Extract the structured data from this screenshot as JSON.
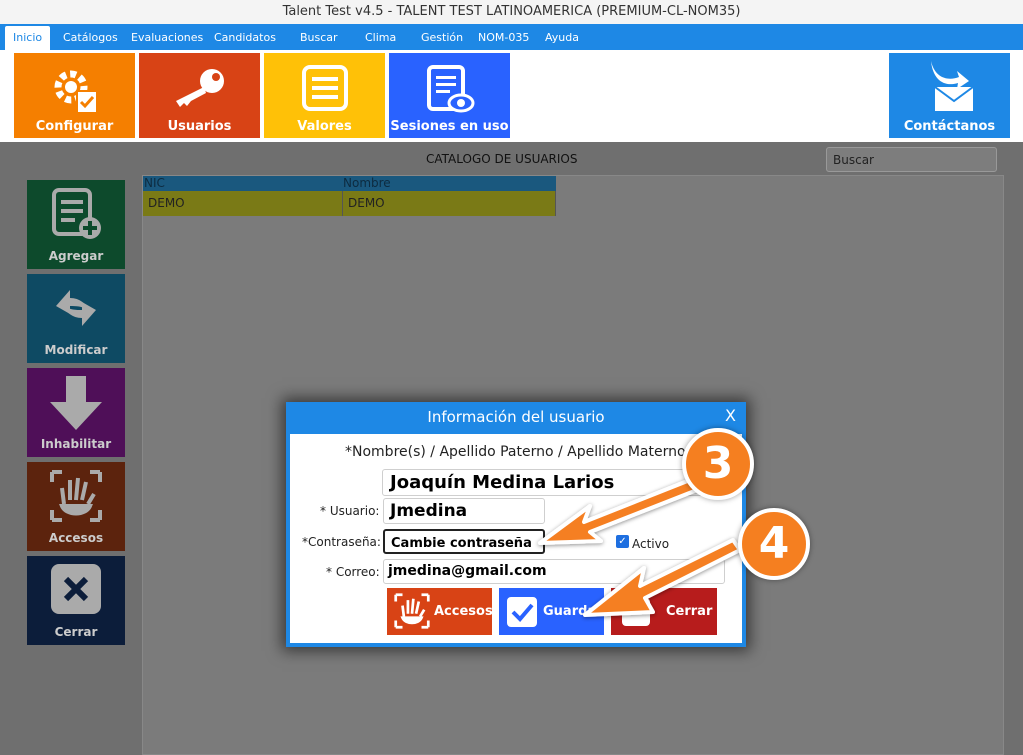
{
  "window": {
    "title": "Talent Test v4.5 - TALENT TEST LATINOAMERICA (PREMIUM-CL-NOM35)"
  },
  "menu": {
    "inicio": "Inicio",
    "catalogos": "Catálogos",
    "evaluaciones": "Evaluaciones",
    "candidatos": "Candidatos",
    "buscar": "Buscar",
    "clima": "Clima",
    "gestion": "Gestión",
    "nom035": "NOM-035",
    "ayuda": "Ayuda"
  },
  "toolbar": {
    "configurar": "Configurar",
    "usuarios": "Usuarios",
    "valores": "Valores",
    "sesiones": "Sesiones en uso",
    "contactanos": "Contáctanos"
  },
  "catalog": {
    "title": "CATALOGO DE USUARIOS",
    "search_placeholder": "Buscar",
    "columns": {
      "nic": "NIC",
      "nombre": "Nombre"
    },
    "rows": [
      {
        "nic": "DEMO",
        "nombre": "DEMO"
      }
    ]
  },
  "sidebar": {
    "agregar": "Agregar",
    "modificar": "Modificar",
    "habilitar": "Inhabilitar",
    "accesos": "Accesos",
    "cerrar": "Cerrar"
  },
  "dialog": {
    "title": "Información del usuario",
    "close": "X",
    "name_label": "*Nombre(s) / Apellido Paterno / Apellido Materno",
    "name_value": "Joaquín Medina Larios",
    "user_label": "* Usuario:",
    "user_value": "Jmedina",
    "password_label": "*Contraseña:",
    "password_value": "Cambie contraseña",
    "active_label": "Activo",
    "active_checked": true,
    "email_label": "* Correo:",
    "email_value": "jmedina@gmail.com",
    "btn_accesos": "Accesos",
    "btn_guardar": "Guarda",
    "btn_cerrar": "Cerrar"
  },
  "callouts": {
    "step3": "3",
    "step4": "4"
  },
  "colors": {
    "menu_blue": "#1e88e5",
    "configurar": "#f57f00",
    "usuarios": "#d84315",
    "valores": "#ffc107",
    "sesiones": "#2962ff",
    "callout_orange": "#f57f20"
  }
}
